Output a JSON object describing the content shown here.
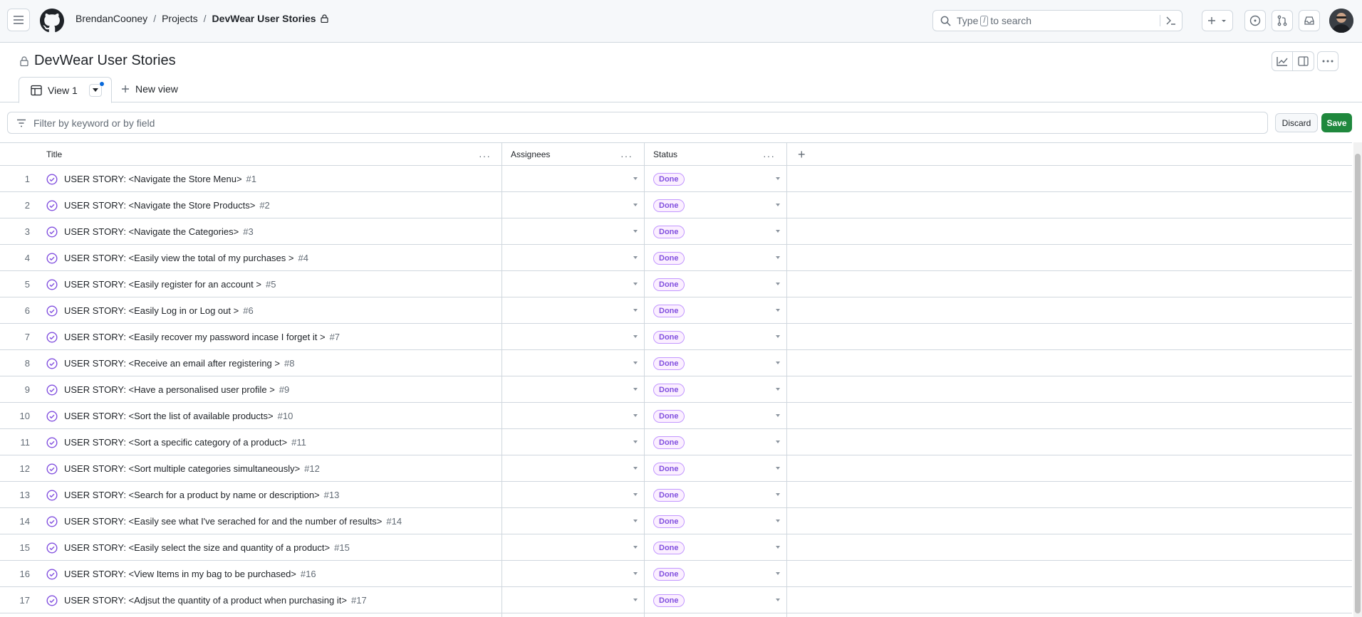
{
  "breadcrumb": {
    "owner": "BrendanCooney",
    "section": "Projects",
    "project": "DevWear User Stories"
  },
  "search": {
    "prefix": "Type",
    "key": "/",
    "suffix": "to search"
  },
  "project": {
    "title": "DevWear User Stories"
  },
  "tabs": {
    "view1": "View 1",
    "new_view": "New view"
  },
  "filter": {
    "placeholder": "Filter by keyword or by field",
    "discard": "Discard",
    "save": "Save"
  },
  "columns": {
    "title": "Title",
    "assignees": "Assignees",
    "status": "Status"
  },
  "colors": {
    "done_text": "#8250df",
    "done_bg": "#fbefff",
    "done_border": "#c297ff",
    "save_bg": "#1f883d",
    "icon_purple": "#8250df"
  },
  "rows": [
    {
      "n": "1",
      "title": "USER STORY: <Navigate the Store Menu>",
      "ref": "#1",
      "status": "Done"
    },
    {
      "n": "2",
      "title": "USER STORY: <Navigate the Store Products>",
      "ref": "#2",
      "status": "Done"
    },
    {
      "n": "3",
      "title": "USER STORY: <Navigate the Categories>",
      "ref": "#3",
      "status": "Done"
    },
    {
      "n": "4",
      "title": "USER STORY: <Easily view the total of my purchases >",
      "ref": "#4",
      "status": "Done"
    },
    {
      "n": "5",
      "title": "USER STORY: <Easily register for an account >",
      "ref": "#5",
      "status": "Done"
    },
    {
      "n": "6",
      "title": "USER STORY: <Easily Log in or Log out >",
      "ref": "#6",
      "status": "Done"
    },
    {
      "n": "7",
      "title": "USER STORY: <Easily recover my password incase I forget it >",
      "ref": "#7",
      "status": "Done"
    },
    {
      "n": "8",
      "title": "USER STORY: <Receive an email after registering >",
      "ref": "#8",
      "status": "Done"
    },
    {
      "n": "9",
      "title": "USER STORY: <Have a personalised user profile >",
      "ref": "#9",
      "status": "Done"
    },
    {
      "n": "10",
      "title": "USER STORY: <Sort the list of available products>",
      "ref": "#10",
      "status": "Done"
    },
    {
      "n": "11",
      "title": "USER STORY: <Sort a specific category of a product>",
      "ref": "#11",
      "status": "Done"
    },
    {
      "n": "12",
      "title": "USER STORY: <Sort multiple categories simultaneously>",
      "ref": "#12",
      "status": "Done"
    },
    {
      "n": "13",
      "title": "USER STORY: <Search for a product by name or description>",
      "ref": "#13",
      "status": "Done"
    },
    {
      "n": "14",
      "title": "USER STORY: <Easily see what I've serached for and the number of results>",
      "ref": "#14",
      "status": "Done"
    },
    {
      "n": "15",
      "title": "USER STORY: <Easily select the size and quantity of a product>",
      "ref": "#15",
      "status": "Done"
    },
    {
      "n": "16",
      "title": "USER STORY: <View Items in my bag to be purchased>",
      "ref": "#16",
      "status": "Done"
    },
    {
      "n": "17",
      "title": "USER STORY: <Adjsut the quantity of a product when purchasing it>",
      "ref": "#17",
      "status": "Done"
    }
  ]
}
